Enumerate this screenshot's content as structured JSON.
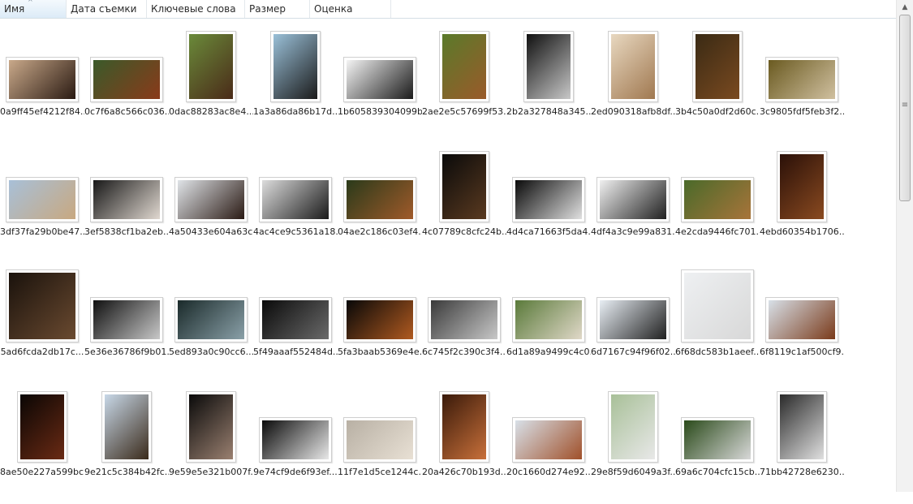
{
  "header": {
    "columns": [
      "Имя",
      "Дата съемки",
      "Ключевые слова",
      "Размер",
      "Оценка"
    ],
    "sorted_column": "Имя"
  },
  "files": [
    {
      "name": "0a9ff45ef4212f84...",
      "orient": "landscape",
      "colors": [
        "#c9a98a",
        "#2a1a12"
      ]
    },
    {
      "name": "0c7f6a8c566c036...",
      "orient": "landscape",
      "colors": [
        "#3a5a2a",
        "#8a3a1a"
      ]
    },
    {
      "name": "0dac88283ac8e4...",
      "orient": "portrait",
      "colors": [
        "#6a8a3a",
        "#4a2a18"
      ]
    },
    {
      "name": "1a3a86da86b17d...",
      "orient": "portrait",
      "colors": [
        "#9ac0d8",
        "#1a1a1a"
      ]
    },
    {
      "name": "1b605839304099b...",
      "orient": "landscape",
      "colors": [
        "#f4f4f4",
        "#1a1a1a"
      ]
    },
    {
      "name": "2ae2e5c57699f53...",
      "orient": "portrait",
      "colors": [
        "#5a7a2a",
        "#9a5a2a"
      ]
    },
    {
      "name": "2b2a327848a345...",
      "orient": "portrait",
      "colors": [
        "#101010",
        "#c8c8c8"
      ]
    },
    {
      "name": "2ed090318afb8df...",
      "orient": "portrait",
      "colors": [
        "#e8d8c0",
        "#a07850"
      ]
    },
    {
      "name": "3b4c50a0df2d60c...",
      "orient": "portrait",
      "colors": [
        "#3a2a14",
        "#7a4a20"
      ]
    },
    {
      "name": "3c9805fdf5feb3f2...",
      "orient": "landscape",
      "colors": [
        "#6a5a20",
        "#d0c0a0"
      ]
    },
    {
      "name": "3df37fa29b0be47...",
      "orient": "landscape",
      "colors": [
        "#a8c0d8",
        "#c8a880"
      ]
    },
    {
      "name": "3ef5838cf1ba2eb...",
      "orient": "landscape",
      "colors": [
        "#181818",
        "#e0d8d0"
      ]
    },
    {
      "name": "4a50433e604a63c...",
      "orient": "landscape",
      "colors": [
        "#e0e4e8",
        "#2a1a14"
      ]
    },
    {
      "name": "4ac4ce9c5361a18...",
      "orient": "landscape",
      "colors": [
        "#dcdcdc",
        "#1a1a1a"
      ]
    },
    {
      "name": "04ae2c186c03ef4...",
      "orient": "landscape",
      "colors": [
        "#2a3a1a",
        "#a05a2a"
      ]
    },
    {
      "name": "4c07789c8cfc24b...",
      "orient": "portrait",
      "colors": [
        "#0a0a0a",
        "#5a3a20"
      ]
    },
    {
      "name": "4d4ca71663f5da4...",
      "orient": "landscape",
      "colors": [
        "#0a0a0a",
        "#e0e0e0"
      ]
    },
    {
      "name": "4df4a3c9e99a831...",
      "orient": "landscape",
      "colors": [
        "#f0f0f0",
        "#202020"
      ]
    },
    {
      "name": "4e2cda9446fc701...",
      "orient": "landscape",
      "colors": [
        "#4a6a2a",
        "#a8743a"
      ]
    },
    {
      "name": "4ebd60354b1706...",
      "orient": "portrait",
      "colors": [
        "#2a1008",
        "#8a4a20"
      ]
    },
    {
      "name": "5ad6fcda2db17c...",
      "orient": "square",
      "colors": [
        "#1a120c",
        "#6a4a30"
      ]
    },
    {
      "name": "5e36e36786f9b01...",
      "orient": "landscape",
      "colors": [
        "#101010",
        "#c8c8c8"
      ]
    },
    {
      "name": "5ed893a0c90cc6...",
      "orient": "landscape",
      "colors": [
        "#1a2a2a",
        "#8aa0a8"
      ]
    },
    {
      "name": "5f49aaaf552484d...",
      "orient": "landscape",
      "colors": [
        "#0a0a0a",
        "#6a6a6a"
      ]
    },
    {
      "name": "5fa3baab5369e4e...",
      "orient": "landscape",
      "colors": [
        "#080808",
        "#b05a20"
      ]
    },
    {
      "name": "6c745f2c390c3f4...",
      "orient": "landscape",
      "colors": [
        "#3a3a3a",
        "#c8c8c8"
      ]
    },
    {
      "name": "6d1a89a9499c4c0...",
      "orient": "landscape",
      "colors": [
        "#5a7a3a",
        "#e0d8c8"
      ]
    },
    {
      "name": "6d7167c94f96f02...",
      "orient": "landscape",
      "colors": [
        "#e8eef4",
        "#202020"
      ]
    },
    {
      "name": "6f68dc583b1aeef...",
      "orient": "square",
      "colors": [
        "#eef0f2",
        "#d8d8d8"
      ]
    },
    {
      "name": "6f8119c1af500cf9...",
      "orient": "landscape",
      "colors": [
        "#d8e0e8",
        "#7a3a1a"
      ]
    },
    {
      "name": "8ae50e227a599bc...",
      "orient": "portrait",
      "colors": [
        "#0a0604",
        "#6a2a14"
      ]
    },
    {
      "name": "9e21c5c384b42fc...",
      "orient": "portrait",
      "colors": [
        "#c8d8e8",
        "#3a2a1a"
      ]
    },
    {
      "name": "9e59e5e321b007f...",
      "orient": "portrait",
      "colors": [
        "#0a0a0a",
        "#9a8070"
      ]
    },
    {
      "name": "9e74cf9de6f93ef...",
      "orient": "landscape",
      "colors": [
        "#0a0a0a",
        "#e8e8e8"
      ]
    },
    {
      "name": "11f7e1d5ce1244c...",
      "orient": "landscape",
      "colors": [
        "#b8b0a4",
        "#e8e0d4"
      ]
    },
    {
      "name": "20a426c70b193d...",
      "orient": "portrait",
      "colors": [
        "#3a1a0a",
        "#c8703a"
      ]
    },
    {
      "name": "20c1660d274e92...",
      "orient": "landscape",
      "colors": [
        "#d8e0e8",
        "#a0502a"
      ]
    },
    {
      "name": "29e8f59d6049a3f...",
      "orient": "portrait",
      "colors": [
        "#a8c098",
        "#e8e8e8"
      ]
    },
    {
      "name": "69a6c704cfc15cb...",
      "orient": "landscape",
      "colors": [
        "#2a4a1a",
        "#d8d8d8"
      ]
    },
    {
      "name": "71bb42728e6230...",
      "orient": "portrait",
      "colors": [
        "#2a2a2a",
        "#e0e0e0"
      ]
    }
  ]
}
